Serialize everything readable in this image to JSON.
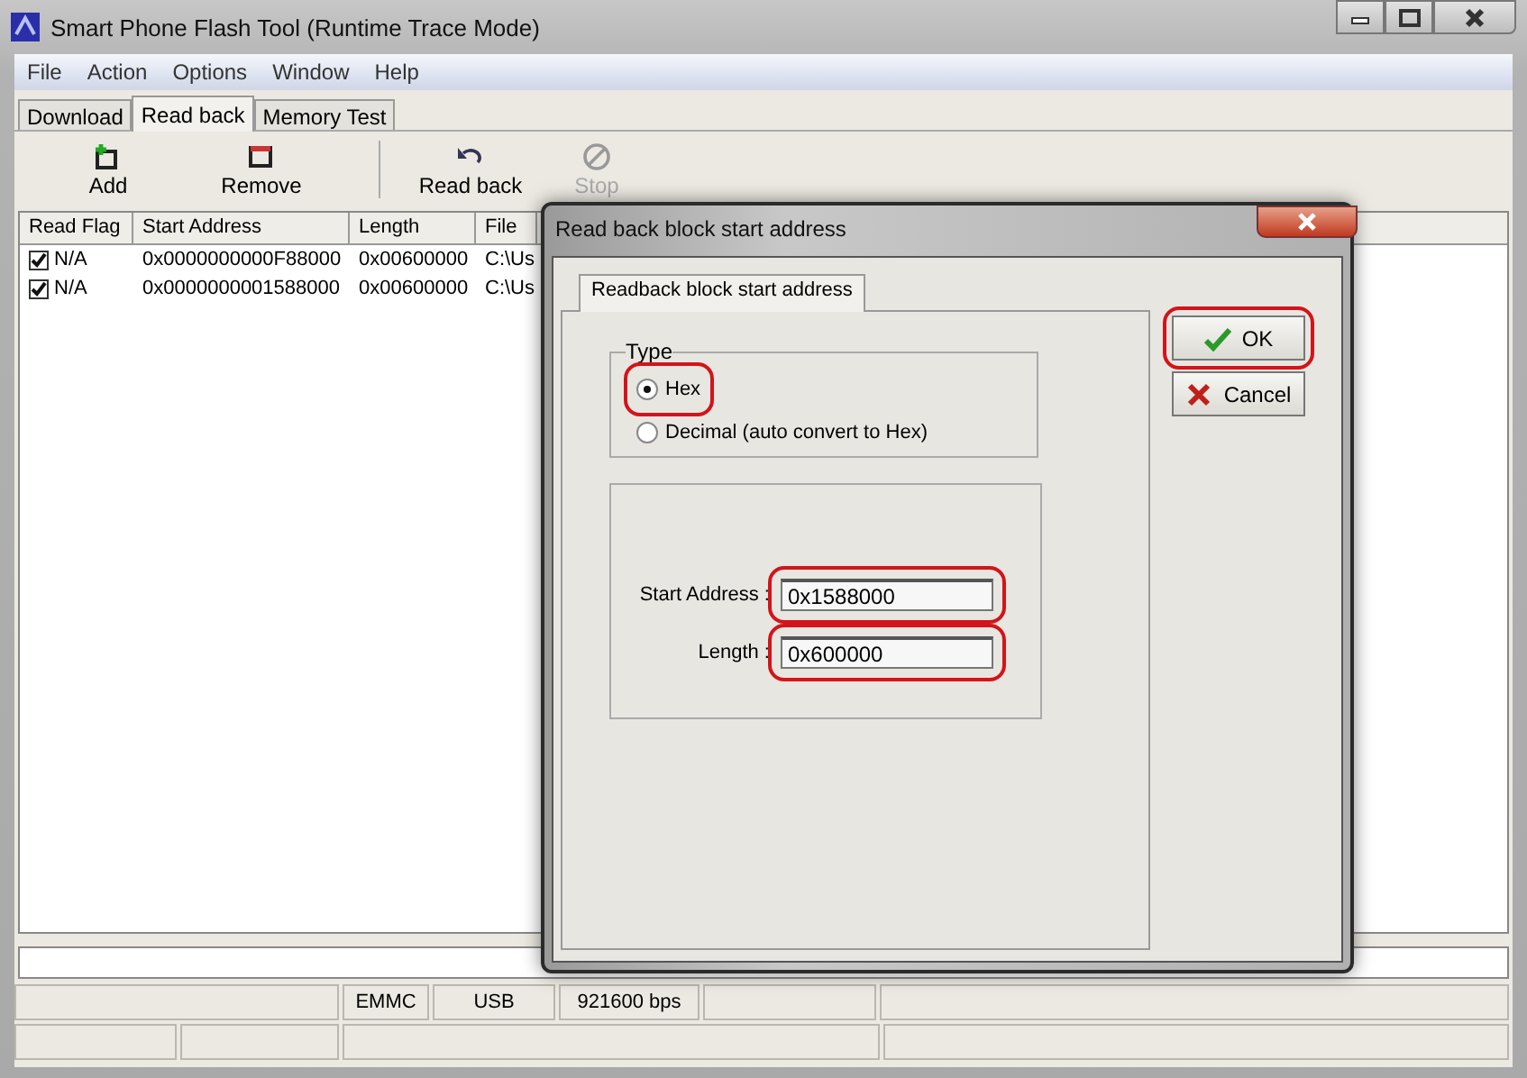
{
  "window": {
    "title": "Smart Phone Flash Tool (Runtime Trace Mode)"
  },
  "menu": [
    "File",
    "Action",
    "Options",
    "Window",
    "Help"
  ],
  "tabs": [
    {
      "label": "Download",
      "selected": false
    },
    {
      "label": "Read back",
      "selected": true
    },
    {
      "label": "Memory Test",
      "selected": false
    }
  ],
  "toolbar": [
    {
      "kind": "add",
      "label": "Add",
      "disabled": false
    },
    {
      "kind": "remove",
      "label": "Remove",
      "disabled": false
    },
    {
      "kind": "readback",
      "label": "Read back",
      "disabled": false
    },
    {
      "kind": "stop",
      "label": "Stop",
      "disabled": true
    }
  ],
  "table": {
    "columns": [
      "Read Flag",
      "Start Address",
      "Length",
      "File"
    ],
    "rows": [
      {
        "checked": true,
        "read_flag": "N/A",
        "start_address": "0x0000000000F88000",
        "length": "0x00600000",
        "file": "C:\\Us"
      },
      {
        "checked": true,
        "read_flag": "N/A",
        "start_address": "0x0000000001588000",
        "length": "0x00600000",
        "file": "C:\\Us"
      }
    ]
  },
  "progress": {
    "level": 0
  },
  "status_bar": [
    "EMMC",
    "USB",
    "921600 bps"
  ],
  "dialog": {
    "title": "Read back block start address",
    "tab": "Readback block start address",
    "group_title": "Type",
    "radios": [
      {
        "label": "Hex",
        "selected": true,
        "highlighted": true
      },
      {
        "label": "Decimal (auto convert to Hex)",
        "selected": false,
        "highlighted": false
      }
    ],
    "fields": [
      {
        "label": "Start Address :",
        "value": "0x1588000",
        "highlighted": true
      },
      {
        "label": "Length :",
        "value": "0x600000",
        "highlighted": true
      }
    ],
    "buttons": [
      {
        "kind": "ok",
        "label": "OK",
        "highlighted": true
      },
      {
        "kind": "cancel",
        "label": "Cancel",
        "highlighted": false
      }
    ]
  }
}
